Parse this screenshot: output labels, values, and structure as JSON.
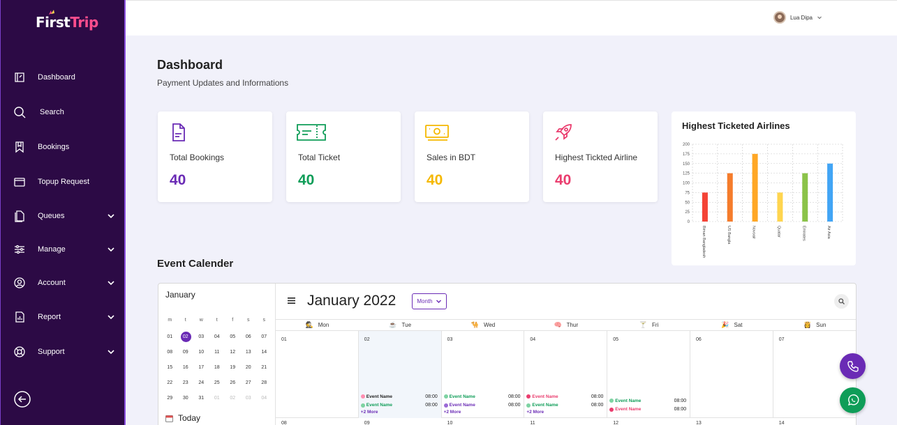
{
  "brand": {
    "name_a": "First",
    "name_b": "Trip"
  },
  "sidebar": {
    "items": [
      {
        "label": "Dashboard",
        "icon": "dashboard-icon"
      },
      {
        "label": "Search",
        "icon": "search-icon"
      },
      {
        "label": "Bookings",
        "icon": "bookmark-icon"
      },
      {
        "label": "Topup Request",
        "icon": "wallet-icon"
      },
      {
        "label": "Queues",
        "icon": "file-icon",
        "expandable": true
      },
      {
        "label": "Manage",
        "icon": "sliders-icon",
        "expandable": true
      },
      {
        "label": "Account",
        "icon": "user-circle-icon",
        "expandable": true
      },
      {
        "label": "Report",
        "icon": "report-icon",
        "expandable": true
      },
      {
        "label": "Support",
        "icon": "lifebuoy-icon",
        "expandable": true
      }
    ]
  },
  "user": {
    "name": "Lua Dipa"
  },
  "page": {
    "title": "Dashboard",
    "subtitle": "Payment Updates and Informations"
  },
  "cards": [
    {
      "label": "Total Bookings",
      "value": "40",
      "color": "#6a2bb5",
      "icon": "document-icon"
    },
    {
      "label": "Total Ticket",
      "value": "40",
      "color": "#0f9d58",
      "icon": "ticket-icon"
    },
    {
      "label": "Sales in BDT",
      "value": "40",
      "color": "#f5b800",
      "icon": "money-icon"
    },
    {
      "label": "Highest Tickted Airline",
      "value": "40",
      "color": "#ea3d6e",
      "icon": "rocket-icon"
    }
  ],
  "chart_data": {
    "type": "bar",
    "title": "Highest Ticketed Airlines",
    "categories": [
      "Biman Bangladesh",
      "US Bangla",
      "Novoair",
      "Quatar",
      "Emirates",
      "Air Asia"
    ],
    "values": [
      75,
      125,
      175,
      75,
      125,
      150
    ],
    "colors": [
      "#f44336",
      "#f57c2c",
      "#ffa726",
      "#ffd54f",
      "#8bc34a",
      "#42a5f5"
    ],
    "ylim": [
      0,
      200
    ],
    "yticks": [
      0,
      25,
      50,
      75,
      100,
      125,
      150,
      175,
      200
    ],
    "grid": true
  },
  "calendar": {
    "section_title": "Event Calender",
    "mini": {
      "month": "January",
      "weekdays": [
        "m",
        "t",
        "w",
        "t",
        "f",
        "s",
        "s"
      ],
      "weeks": [
        [
          {
            "d": "01"
          },
          {
            "d": "02",
            "sel": true
          },
          {
            "d": "03"
          },
          {
            "d": "04"
          },
          {
            "d": "05"
          },
          {
            "d": "06"
          },
          {
            "d": "07"
          }
        ],
        [
          {
            "d": "08"
          },
          {
            "d": "09"
          },
          {
            "d": "10"
          },
          {
            "d": "11"
          },
          {
            "d": "12"
          },
          {
            "d": "13"
          },
          {
            "d": "14"
          }
        ],
        [
          {
            "d": "15"
          },
          {
            "d": "16"
          },
          {
            "d": "17"
          },
          {
            "d": "18"
          },
          {
            "d": "19"
          },
          {
            "d": "20"
          },
          {
            "d": "21"
          }
        ],
        [
          {
            "d": "22"
          },
          {
            "d": "23"
          },
          {
            "d": "24"
          },
          {
            "d": "25"
          },
          {
            "d": "26"
          },
          {
            "d": "27"
          },
          {
            "d": "28"
          }
        ],
        [
          {
            "d": "29"
          },
          {
            "d": "30"
          },
          {
            "d": "31"
          },
          {
            "d": "01",
            "dim": true
          },
          {
            "d": "02",
            "dim": true
          },
          {
            "d": "03",
            "dim": true
          },
          {
            "d": "04",
            "dim": true
          }
        ]
      ],
      "today_label": "Today"
    },
    "title": "January 2022",
    "view_select": "Month",
    "days_of_week": [
      {
        "label": "Mon",
        "emoji": "🕵"
      },
      {
        "label": "Tue",
        "emoji": "☕"
      },
      {
        "label": "Wed",
        "emoji": "🐪"
      },
      {
        "label": "Thur",
        "emoji": "🧠"
      },
      {
        "label": "Fri",
        "emoji": "🍸"
      },
      {
        "label": "Sat",
        "emoji": "🎉"
      },
      {
        "label": "Sun",
        "emoji": "👸"
      }
    ],
    "week1": [
      {
        "num": "01",
        "events": [],
        "more": ""
      },
      {
        "num": "02",
        "highlight": true,
        "events": [
          {
            "name": "Event Name",
            "time": "08:00",
            "color": "#ff8fb1",
            "text": "#222"
          },
          {
            "name": "Event Name",
            "time": "08:00",
            "color": "#7ed3a2",
            "text": "#0f9d58"
          }
        ],
        "more": "+2 More"
      },
      {
        "num": "03",
        "events": [
          {
            "name": "Event Name",
            "time": "08:00",
            "color": "#7ed3a2",
            "text": "#0f9d58"
          },
          {
            "name": "Event Name",
            "time": "08:00",
            "color": "#9b6ad6",
            "text": "#6a2bb5"
          }
        ],
        "more": "+2 More"
      },
      {
        "num": "04",
        "events": [
          {
            "name": "Event Name",
            "time": "08:00",
            "color": "#ea3d6e",
            "text": "#ea3d6e"
          },
          {
            "name": "Event Name",
            "time": "08:00",
            "color": "#7ed3a2",
            "text": "#0f9d58"
          }
        ],
        "more": "+2 More"
      },
      {
        "num": "05",
        "events": [
          {
            "name": "Event Name",
            "time": "08:00",
            "color": "#7ed3a2",
            "text": "#0f9d58"
          },
          {
            "name": "Event Name",
            "time": "08:00",
            "color": "#ea3d6e",
            "text": "#ea3d6e"
          }
        ],
        "more": ""
      },
      {
        "num": "06",
        "events": [],
        "more": ""
      },
      {
        "num": "07",
        "events": [],
        "more": ""
      }
    ],
    "week2": [
      "08",
      "09",
      "10",
      "11",
      "12",
      "13",
      "14"
    ]
  },
  "fabs": [
    {
      "icon": "phone-icon",
      "color": "#6a2bb5"
    },
    {
      "icon": "whatsapp-icon",
      "color": "#0f9d58"
    }
  ]
}
